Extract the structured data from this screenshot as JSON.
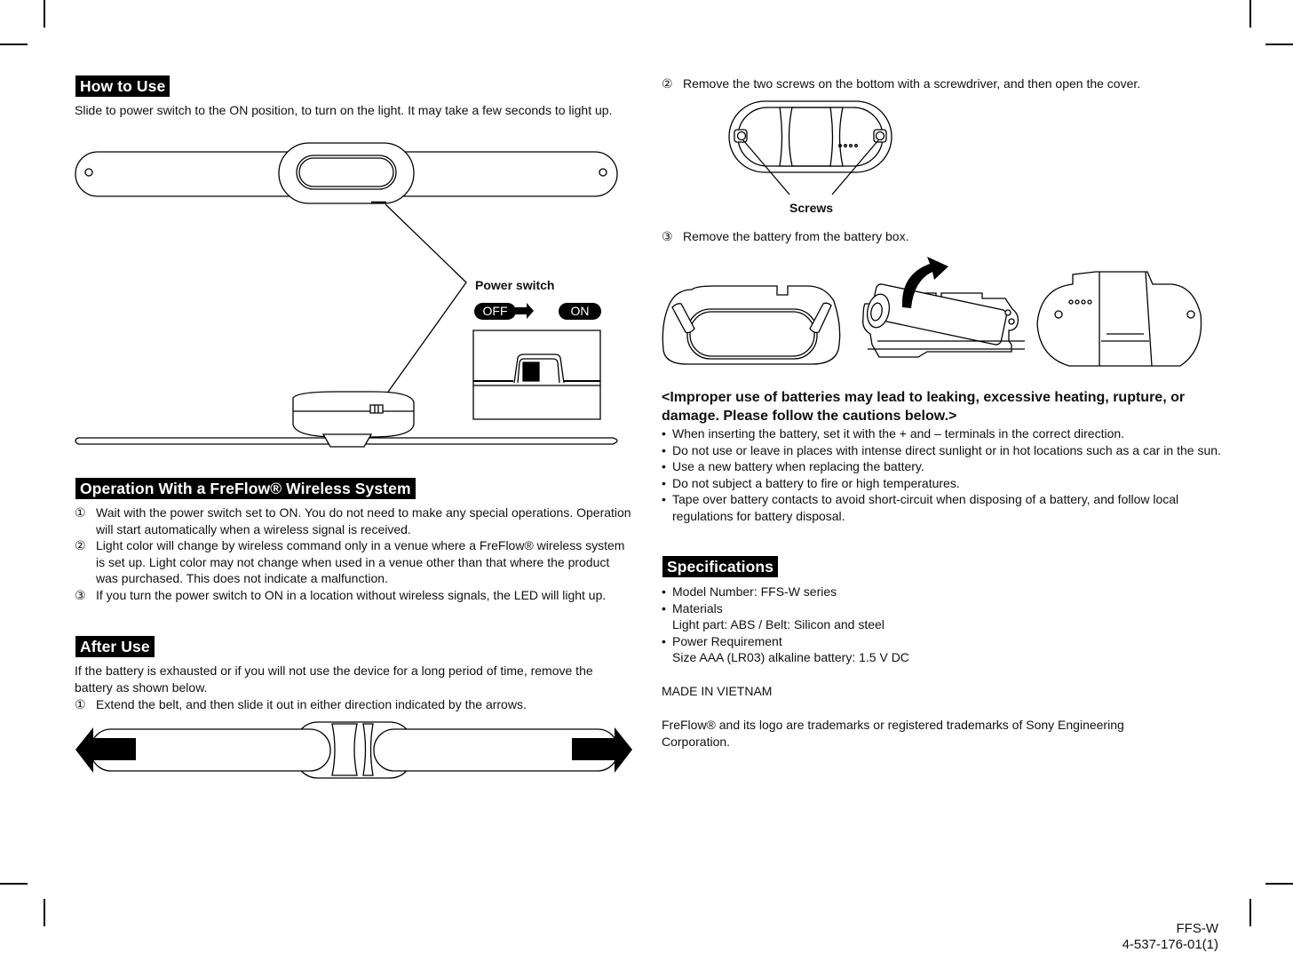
{
  "left_column": {
    "how_to_use": {
      "heading": "How to Use",
      "body": "Slide to power switch to the ON position, to turn on the light. It may take a few seconds to light up.",
      "figure": {
        "power_switch_label": "Power switch",
        "off_label": "OFF",
        "on_label": "ON"
      }
    },
    "operation": {
      "heading": "Operation With a FreFlow® Wireless System",
      "steps": [
        {
          "num": "①",
          "text": "Wait with the power switch set to ON. You do not need to make any special operations. Operation will start automatically when a wireless signal is received."
        },
        {
          "num": "②",
          "text": "Light color will change by wireless command only in a venue where a FreFlow® wireless system is set up. Light color may not change when used in a venue other than that where the product was purchased. This does not indicate a malfunction."
        },
        {
          "num": "③",
          "text": "If you turn the power switch to ON in a location without wireless signals, the LED will light up."
        }
      ]
    },
    "after_use": {
      "heading": "After Use",
      "body": "If the battery is exhausted or if you will not use the device for a long period of time, remove the battery as shown below.",
      "step1": {
        "num": "①",
        "text": "Extend the belt, and then slide it out in either direction indicated by the arrows."
      }
    }
  },
  "right_column": {
    "step2": {
      "num": "②",
      "text": "Remove the two screws on the bottom with a screwdriver, and then open the cover."
    },
    "screws_label": "Screws",
    "step3": {
      "num": "③",
      "text": "Remove the battery from the battery box."
    },
    "caution": {
      "title": "<Improper use of batteries may lead to leaking, excessive heating, rupture, or damage. Please follow the cautions below.>",
      "items": [
        "When inserting the battery, set it with the + and – terminals in the correct direction.",
        "Do not use or leave in places with intense direct sunlight or in hot locations such as a car in the sun.",
        "Use a new battery when replacing the battery.",
        "Do not subject a battery to fire or high temperatures.",
        "Tape over battery contacts to avoid short-circuit when disposing of a battery, and follow local regulations for battery disposal."
      ]
    },
    "specifications": {
      "heading": "Specifications",
      "model": "Model Number: FFS-W series",
      "materials_label": "Materials",
      "materials_value": "Light part: ABS / Belt: Silicon and steel",
      "power_label": "Power Requirement",
      "power_value": "Size AAA (LR03) alkaline battery: 1.5 V DC",
      "origin": "MADE IN VIETNAM",
      "trademark": "FreFlow® and its logo are trademarks or registered trademarks of Sony Engineering Corporation."
    }
  },
  "footer": {
    "model": "FFS-W",
    "part_number": "4-537-176-01(1)"
  }
}
